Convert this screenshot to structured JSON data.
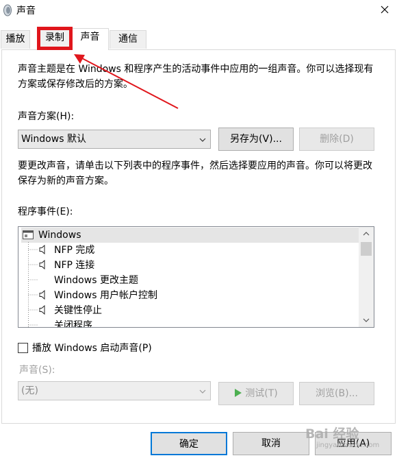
{
  "window": {
    "title": "声音"
  },
  "tabs": [
    {
      "label": "播放"
    },
    {
      "label": "录制"
    },
    {
      "label": "声音"
    },
    {
      "label": "通信"
    }
  ],
  "sounds_tab": {
    "description": "声音主题是在 Windows 和程序产生的活动事件中应用的一组声音。你可以选择现有方案或保存修改后的方案。",
    "scheme_label": "声音方案(H):",
    "scheme_value": "Windows 默认",
    "save_as_label": "另存为(V)...",
    "delete_label": "删除(D)",
    "change_desc": "要更改声音，请单击以下列表中的程序事件，然后选择要应用的声音。你可以将更改保存为新的声音方案。",
    "events_label": "程序事件(E):",
    "events": [
      {
        "label": "Windows",
        "icon": "windows-app-icon",
        "level": 0
      },
      {
        "label": "NFP 完成",
        "icon": "speaker-icon",
        "level": 1
      },
      {
        "label": "NFP 连接",
        "icon": "speaker-icon",
        "level": 1
      },
      {
        "label": "Windows 更改主题",
        "icon": "",
        "level": 1
      },
      {
        "label": "Windows 用户帐户控制",
        "icon": "speaker-icon",
        "level": 1
      },
      {
        "label": "关键性停止",
        "icon": "speaker-icon",
        "level": 1
      },
      {
        "label": "关闭程序",
        "icon": "",
        "level": 1
      }
    ],
    "startup_checkbox_label": "播放 Windows 启动声音(P)",
    "startup_checked": false,
    "sound_label": "声音(S):",
    "sound_value": "(无)",
    "test_label": "测试(T)",
    "browse_label": "浏览(B)..."
  },
  "footer": {
    "ok_label": "确定",
    "cancel_label": "取消",
    "apply_label": "应用(A)"
  },
  "watermark": {
    "text": "Bai 经验",
    "subtext": "jingyan.baidu.com"
  },
  "colors": {
    "annotation_red": "#e0161c",
    "focus_blue": "#0078d7",
    "play_green": "#4caf50"
  }
}
